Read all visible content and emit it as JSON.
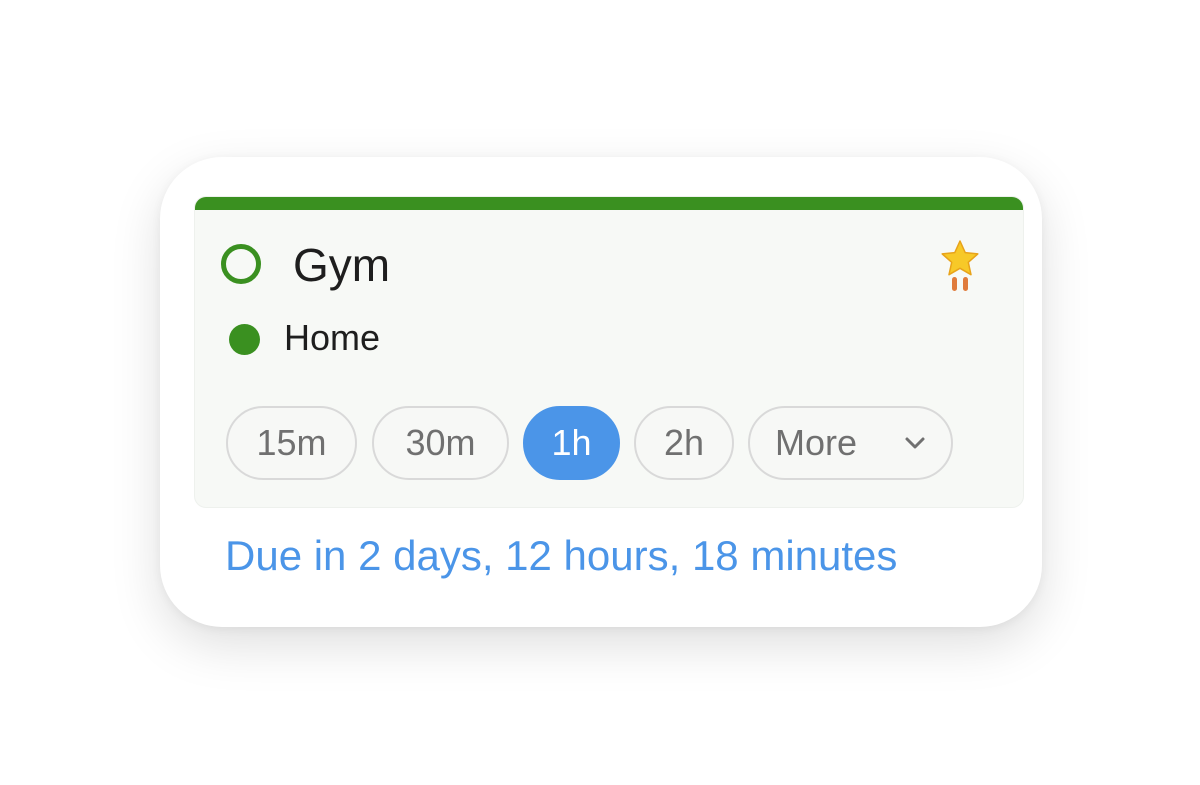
{
  "task": {
    "title": "Gym",
    "completed": false,
    "list_name": "Home",
    "starred": true,
    "accent_color": "#3a9020",
    "icons": {
      "complete": "circle-outline-icon",
      "star": "star-icon",
      "list": "dot-icon",
      "dropdown": "chevron-down-icon"
    }
  },
  "duration": {
    "options": [
      "15m",
      "30m",
      "1h",
      "2h"
    ],
    "selected": "1h",
    "more_label": "More",
    "selected_color": "#4b95e8"
  },
  "due": {
    "text": "Due in 2 days, 12 hours, 18 minutes",
    "color": "#4b95e8"
  }
}
